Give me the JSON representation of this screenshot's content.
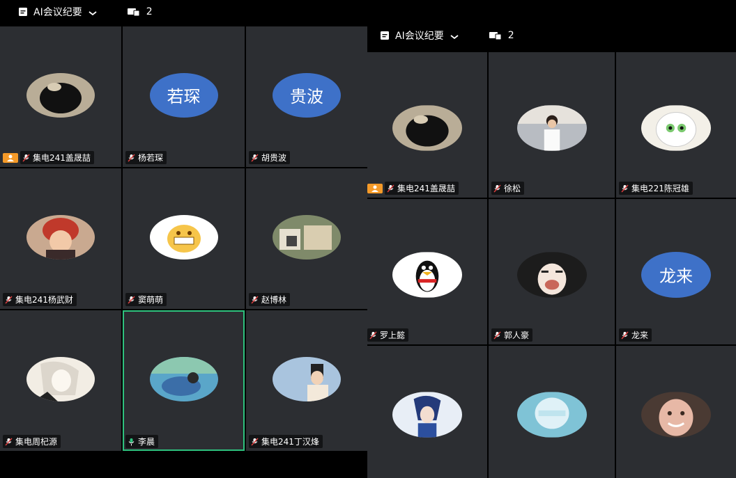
{
  "left": {
    "topbar": {
      "ai_label": "AI会议纪要",
      "participant_count": "2"
    },
    "tiles": [
      {
        "name": "集电241盖晟喆",
        "host": true,
        "avatar": "photo",
        "avatar_desc": "dog-nose"
      },
      {
        "name": "杨若琛",
        "host": false,
        "avatar": "initials",
        "initials": "若琛"
      },
      {
        "name": "胡贵波",
        "host": false,
        "avatar": "initials",
        "initials": "贵波"
      },
      {
        "name": "集电241杨武财",
        "host": false,
        "avatar": "photo",
        "avatar_desc": "anime-red-hair"
      },
      {
        "name": "窦萌萌",
        "host": false,
        "avatar": "photo",
        "avatar_desc": "grin-emoji"
      },
      {
        "name": "赵博林",
        "host": false,
        "avatar": "photo",
        "avatar_desc": "painting"
      },
      {
        "name": "集电周杞源",
        "host": false,
        "avatar": "photo",
        "avatar_desc": "anime-sketch"
      },
      {
        "name": "李晨",
        "host": false,
        "avatar": "photo",
        "avatar_desc": "landscape",
        "active": true
      },
      {
        "name": "集电241丁汉烽",
        "host": false,
        "avatar": "photo",
        "avatar_desc": "person-sky"
      }
    ]
  },
  "right": {
    "topbar": {
      "ai_label": "AI会议纪要",
      "participant_count": "2"
    },
    "tiles": [
      {
        "name": "集电241盖晟喆",
        "host": true,
        "avatar": "photo",
        "avatar_desc": "dog-nose"
      },
      {
        "name": "徐松",
        "host": false,
        "avatar": "photo",
        "avatar_desc": "person-white-shirt"
      },
      {
        "name": "集电221陈冠雄",
        "host": false,
        "avatar": "photo",
        "avatar_desc": "sheep-cartoon"
      },
      {
        "name": "罗上懿",
        "host": false,
        "avatar": "photo",
        "avatar_desc": "qq-penguin"
      },
      {
        "name": "郭人豪",
        "host": false,
        "avatar": "photo",
        "avatar_desc": "anime-girl"
      },
      {
        "name": "龙来",
        "host": false,
        "avatar": "initials",
        "initials": "龙来"
      },
      {
        "name": "",
        "host": false,
        "avatar": "photo",
        "avatar_desc": "anime-blue"
      },
      {
        "name": "",
        "host": false,
        "avatar": "photo",
        "avatar_desc": "anime-cyan"
      },
      {
        "name": "",
        "host": false,
        "avatar": "photo",
        "avatar_desc": "child-face"
      }
    ]
  },
  "colors": {
    "tile_bg": "#2c2e32",
    "initials_bg": "#3e71c8",
    "host_badge": "#f59a28",
    "active_border": "#2ec27e"
  }
}
